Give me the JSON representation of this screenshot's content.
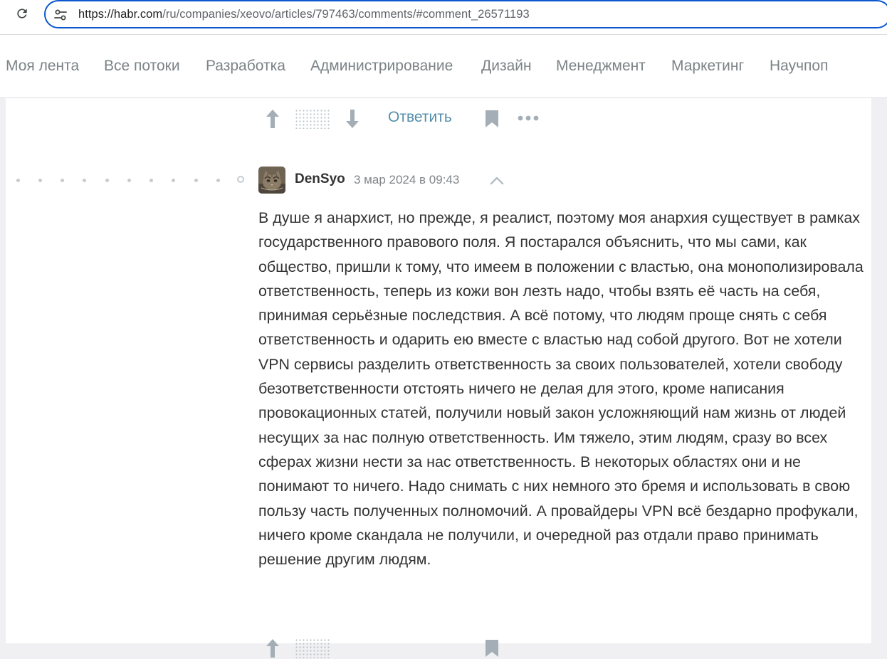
{
  "browser": {
    "url_domain": "https://habr.com",
    "url_path": "/ru/companies/xeovo/articles/797463/comments/#comment_26571193"
  },
  "nav": {
    "items": [
      {
        "label": "Моя лента"
      },
      {
        "label": "Все потоки"
      },
      {
        "label": "Разработка"
      },
      {
        "label": "Администрирование"
      },
      {
        "label": "Дизайн"
      },
      {
        "label": "Менеджмент"
      },
      {
        "label": "Маркетинг"
      },
      {
        "label": "Научпоп"
      }
    ]
  },
  "prev_comment_actions": {
    "reply_label": "Ответить",
    "icons": [
      "arrow-up-icon",
      "rating-hidden-icon",
      "arrow-down-icon",
      "bookmark-icon",
      "more-icon"
    ]
  },
  "comment": {
    "author": "DenSyo",
    "timestamp": "3 мар 2024 в 09:43",
    "avatar": "cat-avatar",
    "icons": [
      "chevron-up-icon"
    ],
    "text": "В душе я анархист, но прежде, я реалист, поэтому моя анархия существует в рамках государственного правового поля. Я постарался объяснить, что мы сами, как общество, пришли к тому, что имеем в положении с властью, она монополизировала ответственность, теперь из кожи вон лезть надо, чтобы взять её часть на себя, принимая серьёзные последствия. А всё потому, что людям проще снять с себя ответственность и одарить ею вместе с властью над собой другого. Вот не хотели VPN сервисы разделить ответственность за своих пользователей, хотели свободу безответственности отстоять ничего не делая для этого, кроме написания провокационных статей, получили новый закон усложняющий нам жизнь от людей несущих за нас полную ответственность. Им тяжело, этим людям, сразу во всех сферах жизни нести за нас ответственность. В некоторых областях они и не понимают то ничего. Надо снимать с них немного это бремя и использовать в свою пользу часть полученных полномочий. А провайдеры VPN всё бездарно профукали, ничего кроме скандала не получили, и очередной раз отдали право принимать решение другим людям."
  },
  "colors": {
    "accent_link": "#548eaa",
    "nav_text": "#7b8387",
    "url_focus_border": "#0b57d0",
    "icon_gray": "#a3aeb6"
  }
}
